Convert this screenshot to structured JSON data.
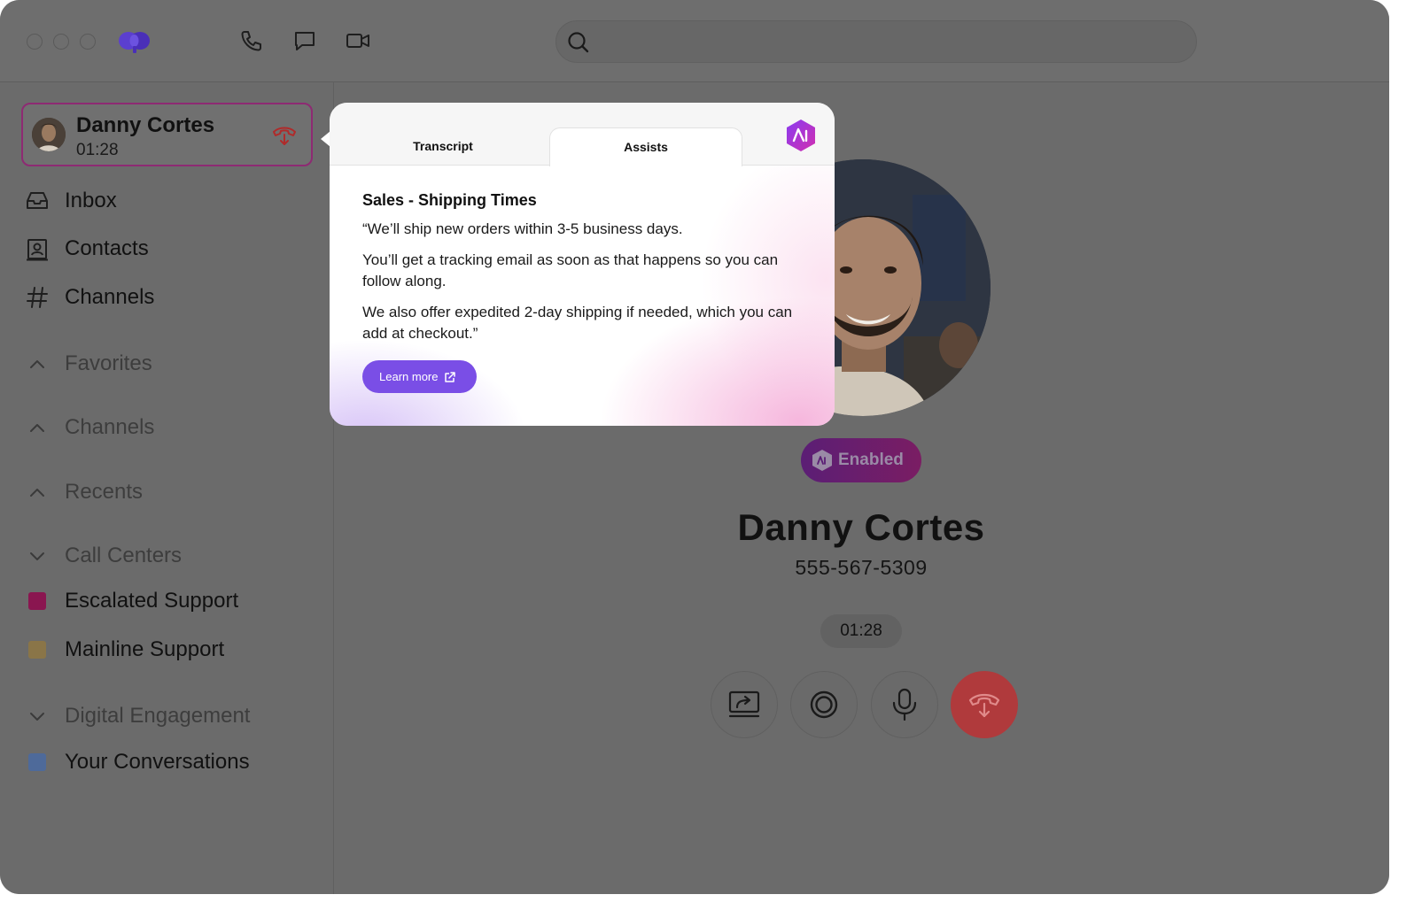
{
  "window": {
    "traffic_lights": [
      "close",
      "minimize",
      "zoom"
    ],
    "toolbar_icons": [
      "phone-icon",
      "chat-icon",
      "video-icon"
    ],
    "search": {
      "placeholder": ""
    }
  },
  "active_call": {
    "name": "Danny Cortes",
    "duration": "01:28"
  },
  "sidebar": {
    "nav": [
      {
        "label": "Inbox",
        "icon": "inbox-icon"
      },
      {
        "label": "Contacts",
        "icon": "contacts-icon"
      },
      {
        "label": "Channels",
        "icon": "hash-icon"
      }
    ],
    "sections": [
      {
        "label": "Favorites",
        "state": "collapsed"
      },
      {
        "label": "Channels",
        "state": "collapsed"
      },
      {
        "label": "Recents",
        "state": "collapsed"
      },
      {
        "label": "Call Centers",
        "state": "expanded"
      },
      {
        "label": "Digital Engagement",
        "state": "expanded"
      }
    ],
    "call_centers": [
      {
        "label": "Escalated Support",
        "color": "#8a1650"
      },
      {
        "label": "Mainline Support",
        "color": "#8a7548"
      }
    ],
    "digital_engagement": [
      {
        "label": "Your Conversations",
        "color": "#4e6a9a"
      }
    ]
  },
  "popover": {
    "tabs": [
      {
        "label": "Transcript",
        "active": false
      },
      {
        "label": "Assists",
        "active": true
      }
    ],
    "title": "Sales - Shipping Times",
    "paragraphs": [
      "“We’ll ship new orders within 3-5 business days.",
      "You’ll get a tracking email as soon as that happens so you can follow along.",
      "We also offer expedited 2-day shipping if needed, which you can add at checkout.”"
    ],
    "learn_more": "Learn more",
    "accent": "#7a4ee6"
  },
  "call": {
    "status_badge": "Enabled",
    "name": "Danny Cortes",
    "phone": "555-567-5309",
    "timer": "01:28",
    "controls": [
      "screen-share-icon",
      "record-icon",
      "microphone-icon",
      "hang-up-icon"
    ],
    "hangup_color": "#b03a3c"
  }
}
